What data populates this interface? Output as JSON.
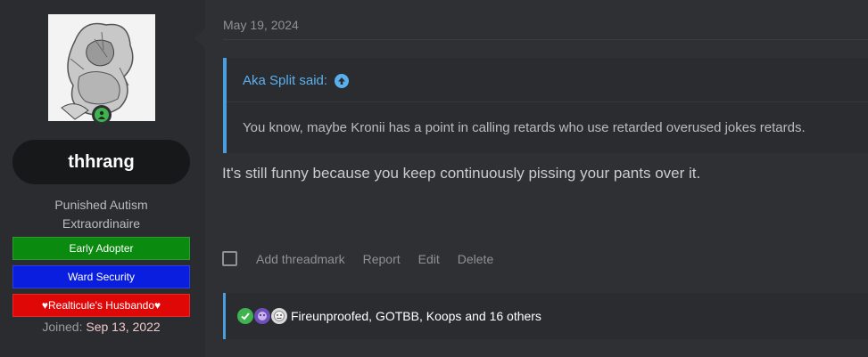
{
  "user": {
    "username": "thhrang",
    "title_line1": "Punished Autism",
    "title_line2": "Extraordinaire",
    "banners": [
      {
        "label": "Early Adopter",
        "color": "#0a8a0f"
      },
      {
        "label": "Ward Security",
        "color": "#0a1ee0"
      },
      {
        "label": "♥Realticule's Husbando♥",
        "color": "#e00707"
      }
    ],
    "joined_label": "Joined:",
    "joined_date": "Sep 13, 2022",
    "status_icon": "online-user-icon"
  },
  "post": {
    "date": "May 19, 2024",
    "quote": {
      "author": "Aka Split said:",
      "icon": "jump-to-quote-icon",
      "text": "You know, maybe Kronii has a point in calling retards who use retarded overused jokes retards."
    },
    "message": "It's still funny because you keep continuously pissing your pants over it.",
    "actions": [
      "Add threadmark",
      "Report",
      "Edit",
      "Delete"
    ],
    "reactions_text": "Fireunproofed, GOTBB, Koops and 16 others",
    "reaction_icons": [
      "check-reaction-icon",
      "purple-character-reaction-icon",
      "face-reaction-icon"
    ]
  },
  "colors": {
    "accent": "#4a9ee0",
    "online": "#3fb34f"
  }
}
